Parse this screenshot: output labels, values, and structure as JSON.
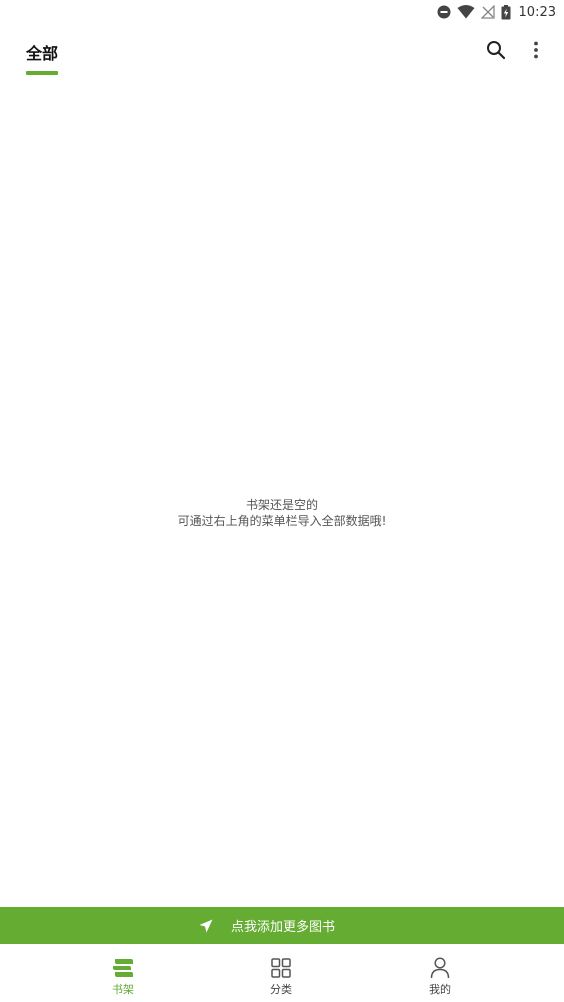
{
  "status_bar": {
    "time": "10:23",
    "icons": [
      "dnd-icon",
      "wifi-icon",
      "no-signal-icon",
      "battery-charging-icon"
    ]
  },
  "top_bar": {
    "active_tab": "全部",
    "actions": [
      "search-icon",
      "more-vert-icon"
    ]
  },
  "empty_state": {
    "line1": "书架还是空的",
    "line2": "可通过右上角的菜单栏导入全部数据哦!"
  },
  "add_banner": {
    "icon": "send-icon",
    "label": "点我添加更多图书"
  },
  "bottom_nav": {
    "items": [
      {
        "label": "书架",
        "icon": "bookshelf-icon",
        "active": true
      },
      {
        "label": "分类",
        "icon": "grid-icon",
        "active": false
      },
      {
        "label": "我的",
        "icon": "person-icon",
        "active": false
      }
    ]
  },
  "colors": {
    "accent": "#64ac32",
    "text": "#222222",
    "muted": "#555555"
  }
}
